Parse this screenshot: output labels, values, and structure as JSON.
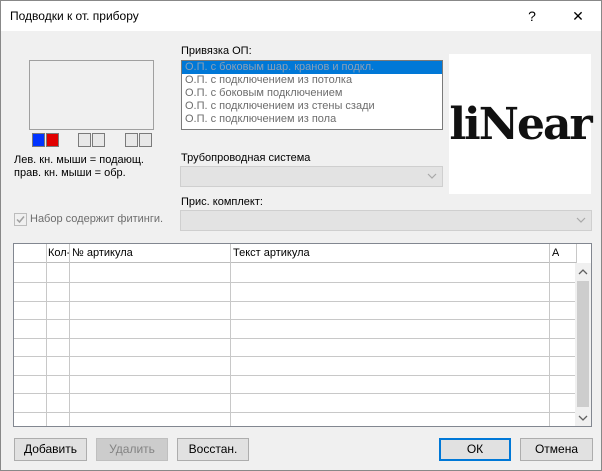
{
  "window": {
    "title": "Подводки к от. прибору",
    "help_glyph": "?",
    "close_glyph": "✕"
  },
  "preview": {
    "swatches": [
      "#0033ff",
      "#e00000",
      "#e8e8e8",
      "#e8e8e8",
      "#e8e8e8",
      "#e8e8e8"
    ],
    "hint_line1": "Лев. кн. мыши = подающ.",
    "hint_line2": "прав. кн. мыши = обр."
  },
  "binding": {
    "label": "Привязка ОП:",
    "items": [
      "О.П. с боковым шар. кранов и подкл.",
      "О.П. с подключением из потолка",
      "О.П. с боковым подключением",
      "О.П. с подключением из стены сзади",
      "О.П. с подключением из пола"
    ],
    "selected_index": 0
  },
  "pipe_system": {
    "label": "Трубопроводная система",
    "value": ""
  },
  "accessory": {
    "label": "Прис. комплект:",
    "value": ""
  },
  "fittings_checkbox": {
    "label": "Набор содержит фитинги.",
    "checked": true
  },
  "logo": {
    "text": "liNear"
  },
  "table": {
    "columns": [
      "",
      "Кол-",
      "№ артикула",
      "Текст артикула",
      "A"
    ]
  },
  "buttons": {
    "add": "Добавить",
    "delete": "Удалить",
    "restore": "Восстан.",
    "ok": "ОК",
    "cancel": "Отмена"
  }
}
